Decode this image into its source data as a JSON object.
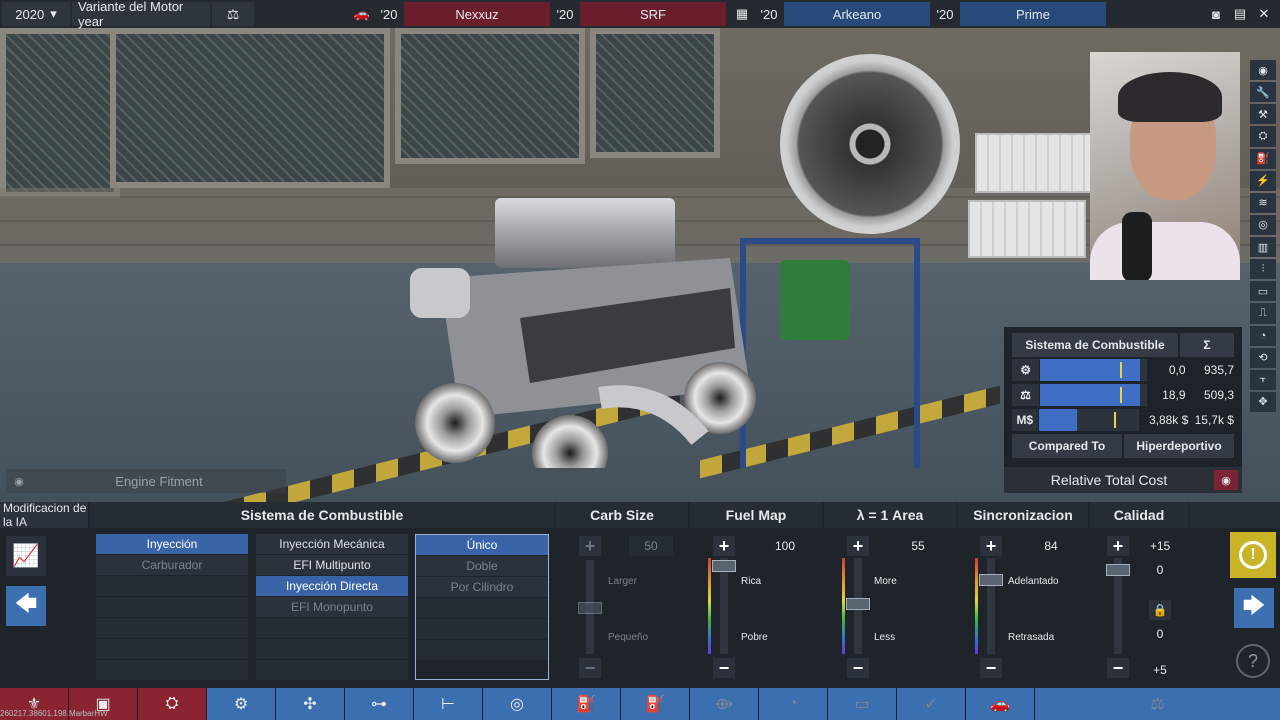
{
  "topbar": {
    "year": "2020",
    "variant_title": "Variante del Motor year",
    "chips": [
      {
        "yr": "'20",
        "label": "Nexxuz",
        "color": "#6b1f2c"
      },
      {
        "yr": "'20",
        "label": "SRF",
        "color": "#6b1f2c"
      },
      {
        "yr": "'20",
        "label": "Arkeano",
        "color": "#284a7a"
      },
      {
        "yr": "'20",
        "label": "Prime",
        "color": "#284a7a"
      }
    ]
  },
  "scene": {
    "engine_fitment_label": "Engine Fitment"
  },
  "stats_panel": {
    "title": "Sistema de Combustible",
    "sigma": "Σ",
    "rows": [
      {
        "icon": "gear-icon",
        "v1": "0,0",
        "v2": "935,7",
        "fill": 0.94,
        "marker": 0.75
      },
      {
        "icon": "weight-icon",
        "v1": "18,9",
        "v2": "509,3",
        "fill": 0.94,
        "marker": 0.75
      },
      {
        "icon": "money-icon",
        "icon_text": "M$",
        "v1": "3,88k $",
        "v2": "15,7k $",
        "fill": 0.38,
        "marker": 0.75
      }
    ],
    "compared_to": "Compared To",
    "class": "Hiperdeportivo",
    "relative_total_cost": "Relative Total Cost"
  },
  "panel": {
    "mod_ia": "Modificacion de la IA",
    "section_title": "Sistema de Combustible",
    "col1": {
      "items": [
        "Inyección",
        "Carburador"
      ]
    },
    "col2": {
      "items": [
        "Inyección Mecánica",
        "EFI Multipunto",
        "Inyección Directa",
        "EFI Monopunto"
      ]
    },
    "col3": {
      "items": [
        "Único",
        "Doble",
        "Por Cilindro"
      ]
    },
    "sliders": {
      "carb_size": {
        "title": "Carb Size",
        "value": "50",
        "top": "Larger",
        "bottom": "Pequeño",
        "level": 0.5
      },
      "fuel_map": {
        "title": "Fuel Map",
        "value": "100",
        "top": "Rica",
        "bottom": "Pobre",
        "level": 1.0
      },
      "lambda": {
        "title": "λ = 1 Area",
        "value": "55",
        "top": "More",
        "bottom": "Less",
        "level": 0.55
      },
      "sync": {
        "title": "Sincronizacion",
        "value": "84",
        "top": "Adelantado",
        "bottom": "Retrasada",
        "level": 0.84
      },
      "quality": {
        "title": "Calidad",
        "top_value": "+15",
        "mid1": "0",
        "mid2": "0",
        "bottom_value": "+5"
      }
    }
  },
  "build_tag": "260217.38601.198.MarbarHW"
}
